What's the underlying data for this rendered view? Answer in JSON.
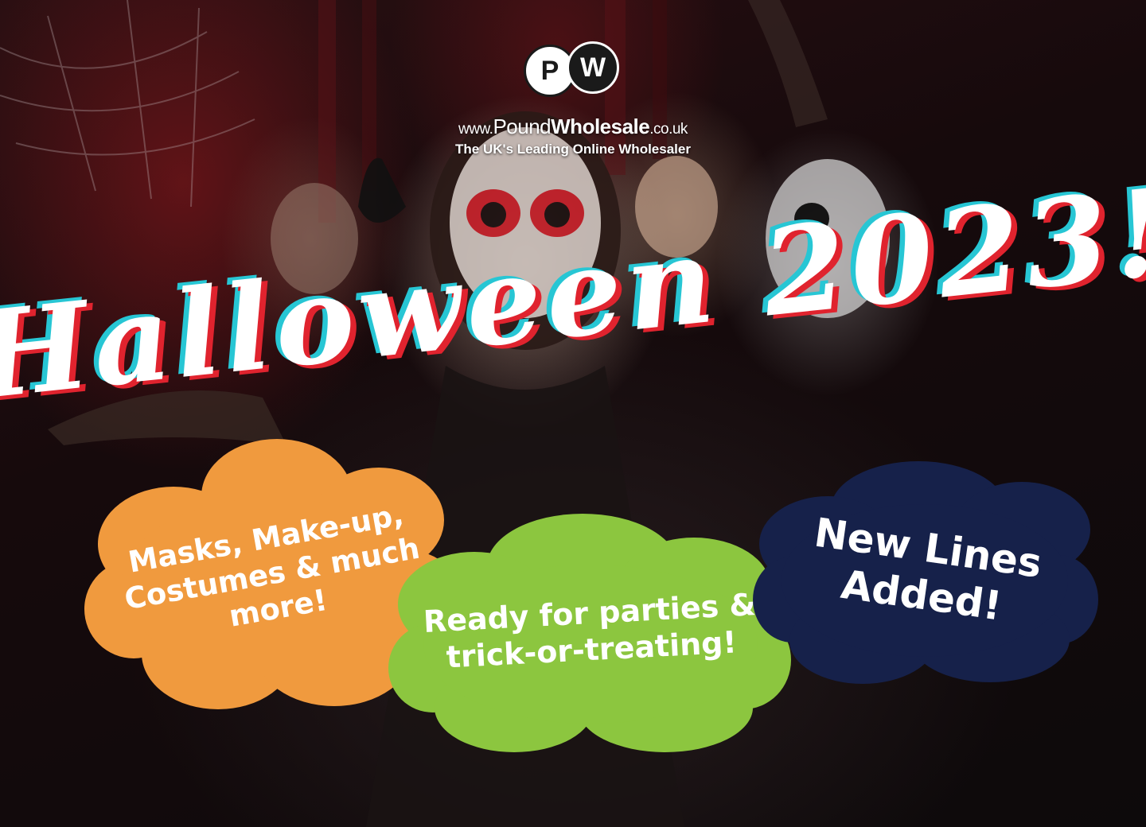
{
  "poster": {
    "logo": {
      "letter_left": "P",
      "letter_right": "W",
      "url_prefix": "www.",
      "url_brand_light": "Pound",
      "url_brand_bold": "Wholesale",
      "url_suffix": ".co.uk",
      "tagline": "The UK's Leading Online Wholesaler"
    },
    "headline": "Halloween 2023!",
    "clouds": [
      {
        "text": "Masks, Make-up, Costumes & much more!",
        "color": "#f09a3e"
      },
      {
        "text": "Ready for parties & trick-or-treating!",
        "color": "#8cc63f"
      },
      {
        "text": "New Lines Added!",
        "color": "#16214a"
      }
    ],
    "colors": {
      "headline_fill": "#ffffff",
      "headline_shadow_red": "#e0232e",
      "headline_shadow_cyan": "#27c6d4"
    }
  }
}
